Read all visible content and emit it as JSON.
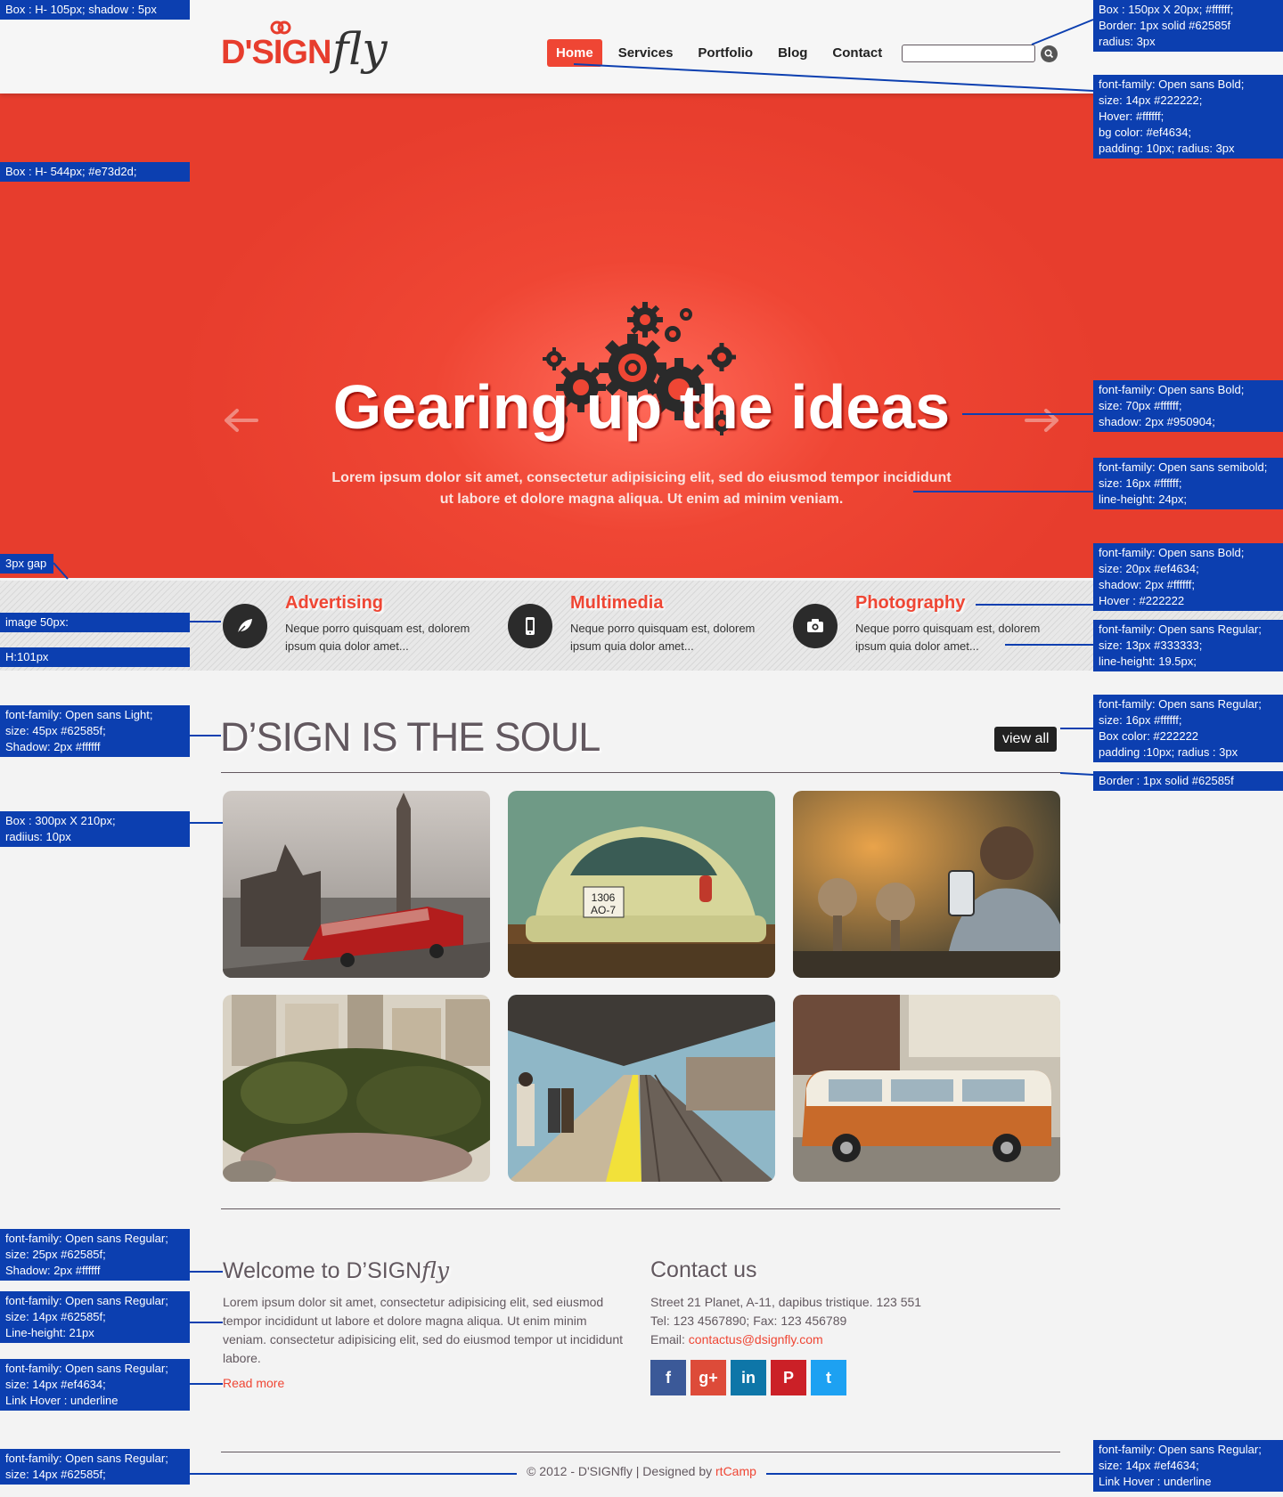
{
  "annotations": {
    "header_box": "Box : H- 105px;  shadow : 5px",
    "hero_box": "Box : H- 544px; #e73d2d;",
    "gap": "3px gap",
    "image_size": "image 50px:",
    "strip_height": "H:101px",
    "section_font": "font-family: Open sans Light;\nsize:  45px #62585f;\nShadow: 2px #ffffff",
    "photo_box": "Box : 300px X 210px;\nradiius: 10px",
    "welcome_font": "font-family: Open sans Regular;\nsize:  25px #62585f;\nShadow: 2px #ffffff",
    "body_font": "font-family: Open sans Regular;\nsize:  14px #62585f;\nLine-height:  21px",
    "link_font": "font-family: Open sans Regular;\nsize:  14px #ef4634;\nLink Hover : underline",
    "footer_font": "font-family: Open sans Regular;\nsize:  14px #62585f;",
    "search_spec": "Box : 150px X 20px; #ffffff;\nBorder: 1px solid #62585f\nradius: 3px",
    "nav_spec": "font-family: Open sans Bold;\nsize:  14px #222222;\nHover: #ffffff;\nbg color: #ef4634;\npadding: 10px; radius: 3px",
    "hero_title_spec": "font-family: Open sans Bold;\nsize:  70px #ffffff;\nshadow: 2px #950904;",
    "hero_sub_spec": "font-family: Open sans semibold;\nsize:  16px #ffffff;\nline-height: 24px;",
    "svc_title_spec": "font-family: Open sans Bold;\nsize:  20px #ef4634;\nshadow: 2px #ffffff;\nHover : #222222",
    "svc_desc_spec": "font-family: Open sans Regular;\nsize:  13px #333333;\nline-height: 19.5px;",
    "view_all_spec": "font-family: Open sans Regular;\nsize:  16px #ffffff;\nBox color: #222222\npadding :10px; radius : 3px",
    "border_spec": "Border : 1px solid #62585f",
    "footer_link_spec": "font-family: Open sans Regular;\nsize:  14px #ef4634;\nLink Hover : underline"
  },
  "header": {
    "logo_main": "D'SIGN",
    "logo_script": "fly",
    "nav": [
      "Home",
      "Services",
      "Portfolio",
      "Blog",
      "Contact"
    ],
    "search_value": "",
    "search_icon": "search-icon"
  },
  "hero": {
    "title": "Gearing up the ideas",
    "subtitle": "Lorem ipsum dolor sit amet, consectetur adipisicing elit, sed do eiusmod tempor incididunt ut labore et dolore magna aliqua. Ut enim ad minim veniam.",
    "icon": "gears-icon",
    "prev_icon": "arrow-left-icon",
    "next_icon": "arrow-right-icon"
  },
  "services": [
    {
      "title": "Advertising",
      "desc": "Neque porro quisquam est, dolorem ipsum quia dolor amet...",
      "icon": "leaf-icon"
    },
    {
      "title": "Multimedia",
      "desc": "Neque porro quisquam est, dolorem ipsum quia dolor amet...",
      "icon": "phone-icon"
    },
    {
      "title": "Photography",
      "desc": "Neque porro quisquam est, dolorem ipsum quia dolor amet...",
      "icon": "camera-icon"
    }
  ],
  "portfolio": {
    "title": "D’SIGN IS THE SOUL",
    "view_all": "view all"
  },
  "welcome": {
    "title_prefix": "Welcome to D’SIGN",
    "title_script": "fly",
    "body": "Lorem ipsum dolor sit amet, consectetur adipisicing elit, sed  eiusmod tempor incididunt ut labore et dolore magna aliqua. Ut enim minim veniam. consectetur adipisicing elit, sed do eiusmod tempor ut incididunt labore.",
    "read_more": "Read more"
  },
  "contact": {
    "title": "Contact us",
    "address": "Street 21 Planet, A-11, dapibus tristique. 123 551",
    "phone": "Tel: 123 4567890; Fax: 123 456789",
    "email_label": "Email: ",
    "email": "contactus@dsignfly.com",
    "social": [
      {
        "icon": "facebook-icon",
        "glyph": "f",
        "color": "#3b5998"
      },
      {
        "icon": "google-plus-icon",
        "glyph": "g+",
        "color": "#dd4b39"
      },
      {
        "icon": "linkedin-icon",
        "glyph": "in",
        "color": "#0e76a8"
      },
      {
        "icon": "pinterest-icon",
        "glyph": "P",
        "color": "#cb2027"
      },
      {
        "icon": "twitter-icon",
        "glyph": "t",
        "color": "#1da1f2"
      }
    ]
  },
  "footer": {
    "copyright": "© 2012 - D'SIGNfly | Designed by ",
    "credit": "rtCamp"
  },
  "colors": {
    "accent": "#ef4634",
    "hero_bg": "#e73d2d",
    "text": "#62585f",
    "dark": "#222222",
    "annotation": "#0c3fb0"
  }
}
